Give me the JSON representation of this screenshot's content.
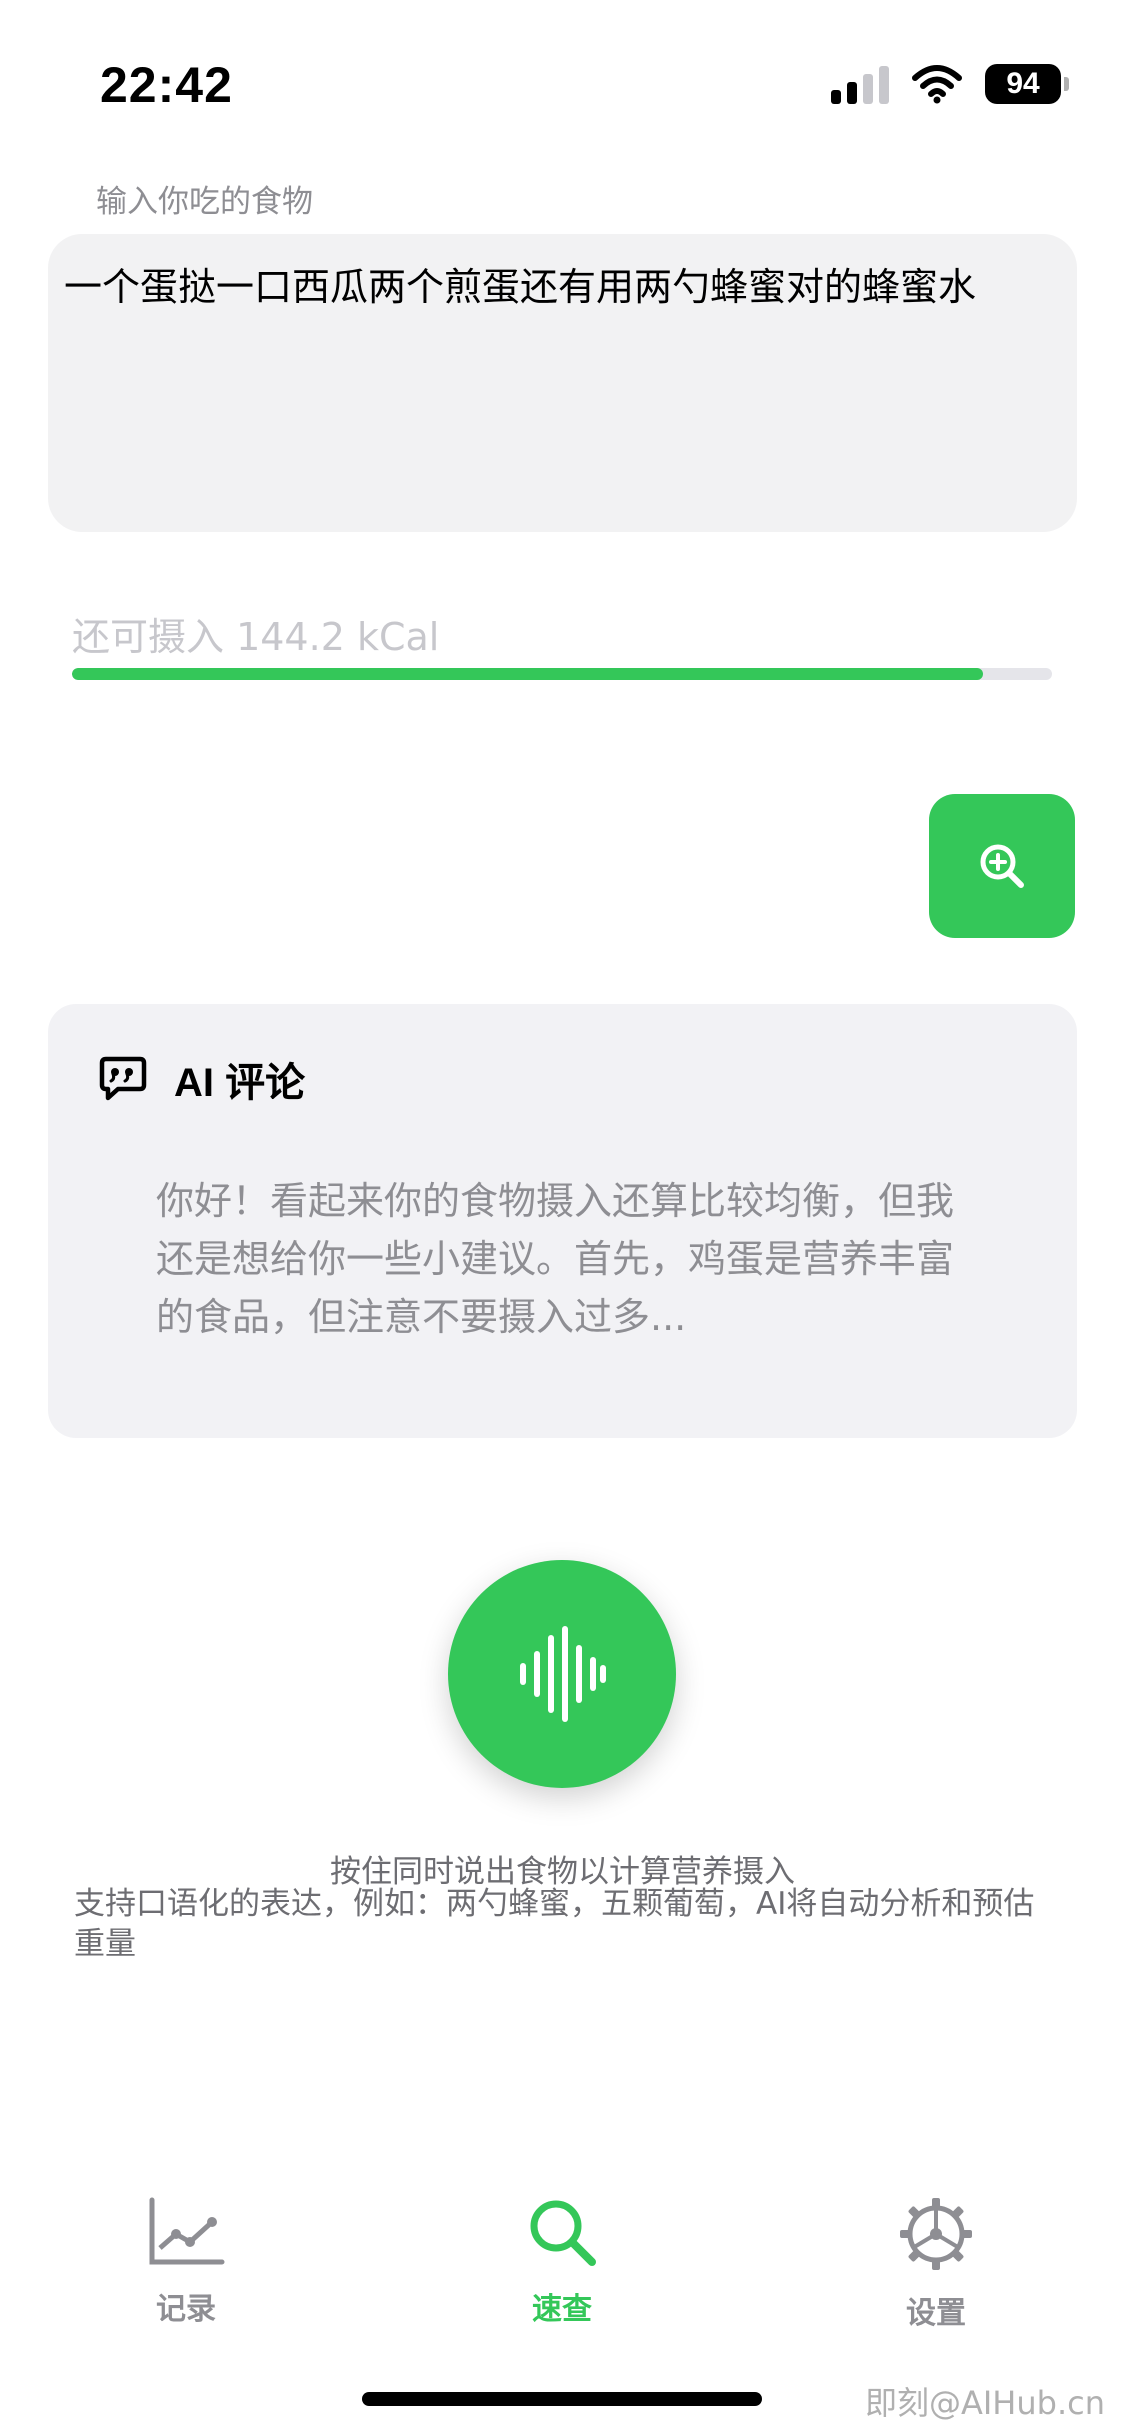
{
  "status_bar": {
    "time": "22:42",
    "battery": "94",
    "signal_icon": "cellular-signal-icon",
    "wifi_icon": "wifi-icon"
  },
  "food_input": {
    "label": "输入你吃的食物",
    "value": "一个蛋挞一口西瓜两个煎蛋还有用两勺蜂蜜对的蜂蜜水"
  },
  "intake": {
    "remaining_text": "还可摄入 144.2 kCal",
    "progress_fraction": 0.93
  },
  "search_button": {
    "icon": "zoom-in-icon"
  },
  "ai_comment": {
    "title": "AI 评论",
    "icon": "quote-chat-bubble-icon",
    "text": "你好！看起来你的食物摄入还算比较均衡，但我还是想给你一些小建议。首先，鸡蛋是营养丰富的食品，但注意不要摄入过多..."
  },
  "voice": {
    "icon": "sound-wave-icon",
    "hint_primary": "按住同时说出食物以计算营养摄入",
    "hint_secondary": "支持口语化的表达，例如：两勺蜂蜜，五颗葡萄，AI将自动分析和预估重量"
  },
  "tabs": [
    {
      "label": "记录",
      "icon": "line-chart-icon",
      "active": false
    },
    {
      "label": "速查",
      "icon": "search-icon",
      "active": true
    },
    {
      "label": "设置",
      "icon": "gear-icon",
      "active": false
    }
  ],
  "watermark": "即刻@AIHub.cn",
  "colors": {
    "accent": "#34c759",
    "card": "#f2f2f5",
    "secondary_text": "#8e8e93"
  }
}
